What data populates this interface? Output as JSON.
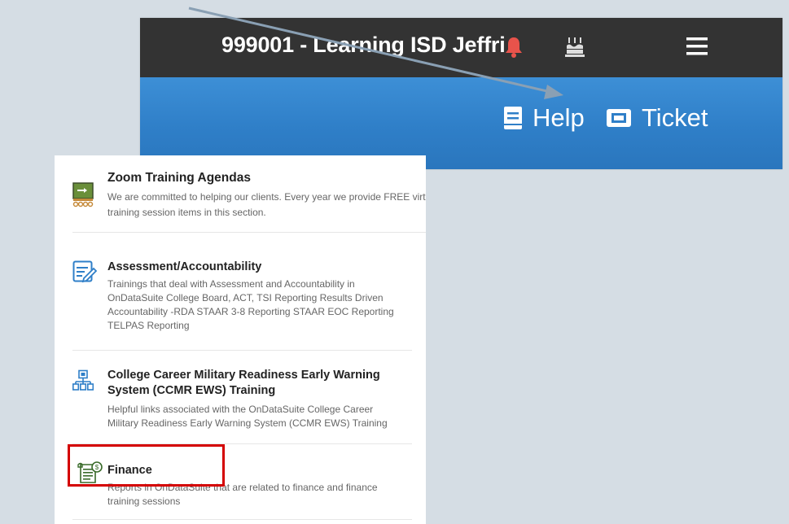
{
  "topbar": {
    "org_name": "999001 - Learning ISD Jeffri",
    "icons": [
      "bell-icon",
      "birthday-cake-icon",
      "moon-icon",
      "hamburger-menu-icon"
    ]
  },
  "subbar": {
    "help_label": "Help",
    "ticket_label": "Ticket"
  },
  "items": [
    {
      "title": "Zoom Training Agendas",
      "desc_line1": "We are committed to helping our clients. Every year we provide FREE virt",
      "desc_line2": "training session items in this section.",
      "icon": "chalkboard-icon"
    },
    {
      "title": "Assessment/Accountability",
      "desc_lines": [
        "Trainings that deal with Assessment and Accountability in",
        "OnDataSuite College Board, ACT, TSI Reporting Results Driven",
        "Accountability -RDA STAAR 3-8 Reporting STAAR EOC Reporting",
        "TELPAS Reporting"
      ],
      "icon": "edit-document-icon"
    },
    {
      "title_line1": "College Career Military Readiness Early Warning",
      "title_line2": "System (CCMR EWS) Training",
      "desc_lines": [
        "Helpful links associated with the OnDataSuite College Career",
        "Military Readiness Early Warning System (CCMR EWS) Training"
      ],
      "icon": "org-chart-icon"
    },
    {
      "title": "Finance",
      "desc_line1": "Reports in OnDataSuite that are related to finance and finance",
      "desc_line2": "training sessions",
      "icon": "finance-scroll-icon"
    }
  ],
  "colors": {
    "topbar": "#333333",
    "subbar": "#2f7fc8",
    "bell": "#e8534b",
    "highlight": "#d40000",
    "arrow": "#8aa0b4"
  }
}
